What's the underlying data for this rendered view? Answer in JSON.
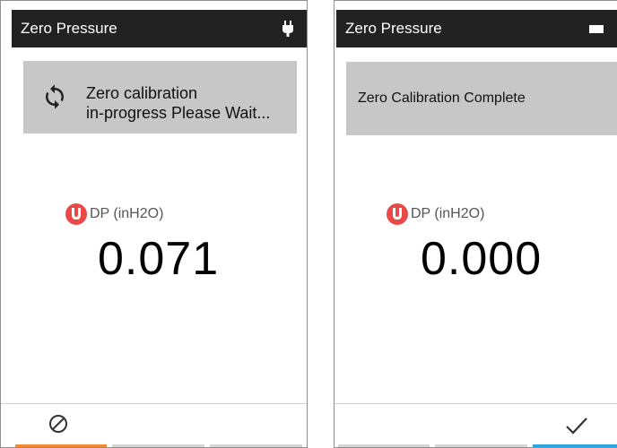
{
  "screens": [
    {
      "title": "Zero Pressure",
      "status_icon": "plug-icon",
      "banner": {
        "icon": "sync-icon",
        "line1": "Zero calibration",
        "line2": "in-progress Please Wait..."
      },
      "measure_label": "DP (inH2O)",
      "reading": "0.071",
      "action_icon": "cancel-icon"
    },
    {
      "title": "Zero Pressure",
      "status_icon": "battery-icon",
      "banner": {
        "message": "Zero Calibration Complete"
      },
      "measure_label": "DP (inH2O)",
      "reading": "0.000",
      "action_icon": "check-icon"
    }
  ],
  "colors": {
    "title_bar": "#222222",
    "banner": "#c7c7c7",
    "sensor_badge": "#ea4a47",
    "cancel_accent": "#f08a33",
    "confirm_accent": "#2aa4dd",
    "inactive_strip": "#d6d6d6"
  }
}
